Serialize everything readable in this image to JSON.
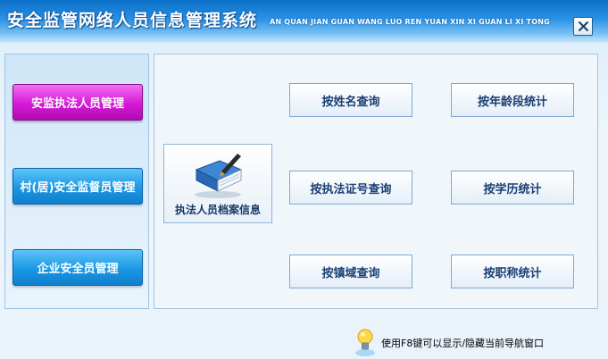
{
  "titlebar": {
    "title": "安全监管网络人员信息管理系统",
    "pinyin": "AN QUAN JIAN GUAN WANG LUO REN YUAN XIN XI GUAN LI XI TONG"
  },
  "sidebar": {
    "items": [
      {
        "label": "安监执法人员管理",
        "active": true
      },
      {
        "label": "村(居)安全监督员管理",
        "active": false
      },
      {
        "label": "企业安全员管理",
        "active": false
      }
    ]
  },
  "main": {
    "archive_label": "执法人员档案信息",
    "buttons": {
      "by_name": "按姓名查询",
      "by_age": "按年龄段统计",
      "by_cert": "按执法证号查询",
      "by_education": "按学历统计",
      "by_town": "按镇域查询",
      "by_title": "按职称统计"
    }
  },
  "status": {
    "hint": "使用F8键可以显示/隐藏当前导航窗口"
  },
  "colors": {
    "title_blue": "#0a6fc8",
    "active_magenta": "#d51ad6",
    "side_blue": "#1a98e4",
    "button_text": "#1b3f73"
  },
  "icons": {
    "close": "close-icon",
    "archive": "book-pen-icon",
    "hint": "lightbulb-icon"
  }
}
